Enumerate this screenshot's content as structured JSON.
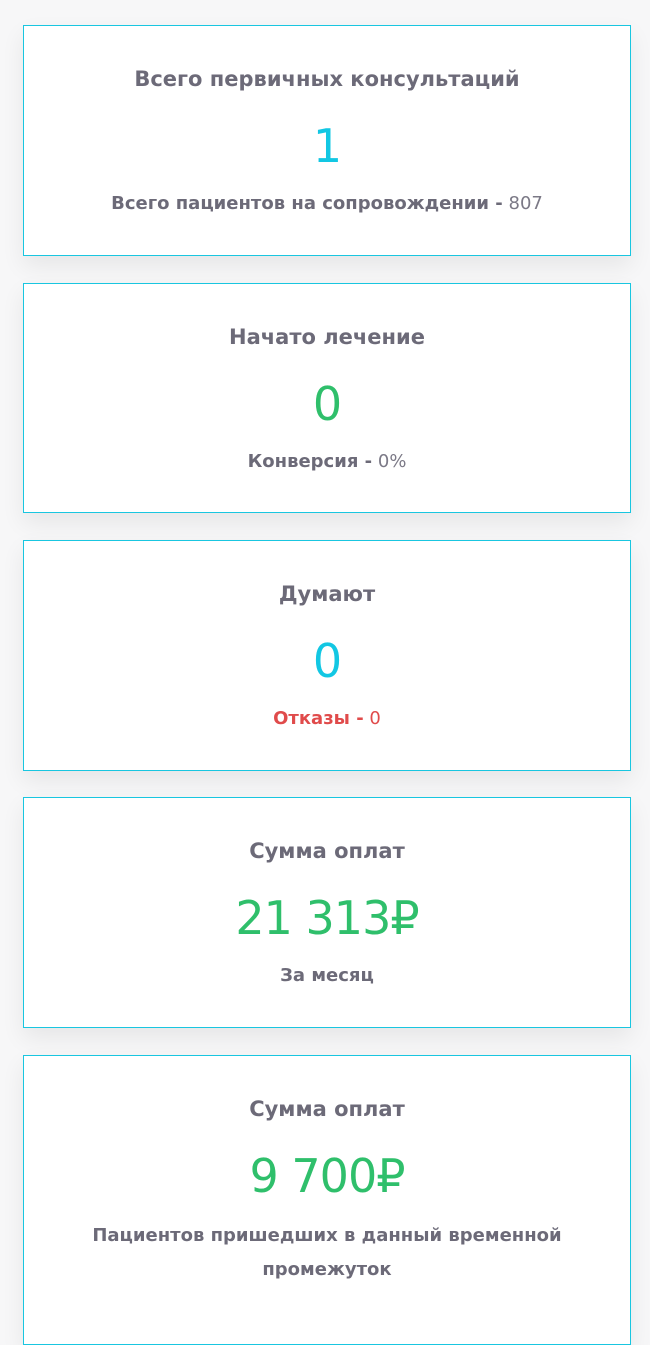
{
  "cards": [
    {
      "title": "Всего первичных консультаций",
      "value": "1",
      "sub_label": "Всего пациентов на сопровождении -",
      "sub_value": "807"
    },
    {
      "title": "Начато лечение",
      "value": "0",
      "sub_label": "Конверсия -",
      "sub_value": "0%"
    },
    {
      "title": "Думают",
      "value": "0",
      "sub_label": "Отказы -",
      "sub_value": "0"
    },
    {
      "title": "Сумма оплат",
      "value": "21 313₽",
      "sub_label": "За месяц"
    },
    {
      "title": "Сумма оплат",
      "value": "9 700₽",
      "sub_label": "Пациентов пришедших в данный временной промежуток"
    }
  ],
  "colors": {
    "border": "#19c6e0",
    "title": "#6c6a78",
    "value_cyan": "#12c7e3",
    "value_green": "#2fbf6b",
    "refusals_red": "#e04b4b"
  }
}
